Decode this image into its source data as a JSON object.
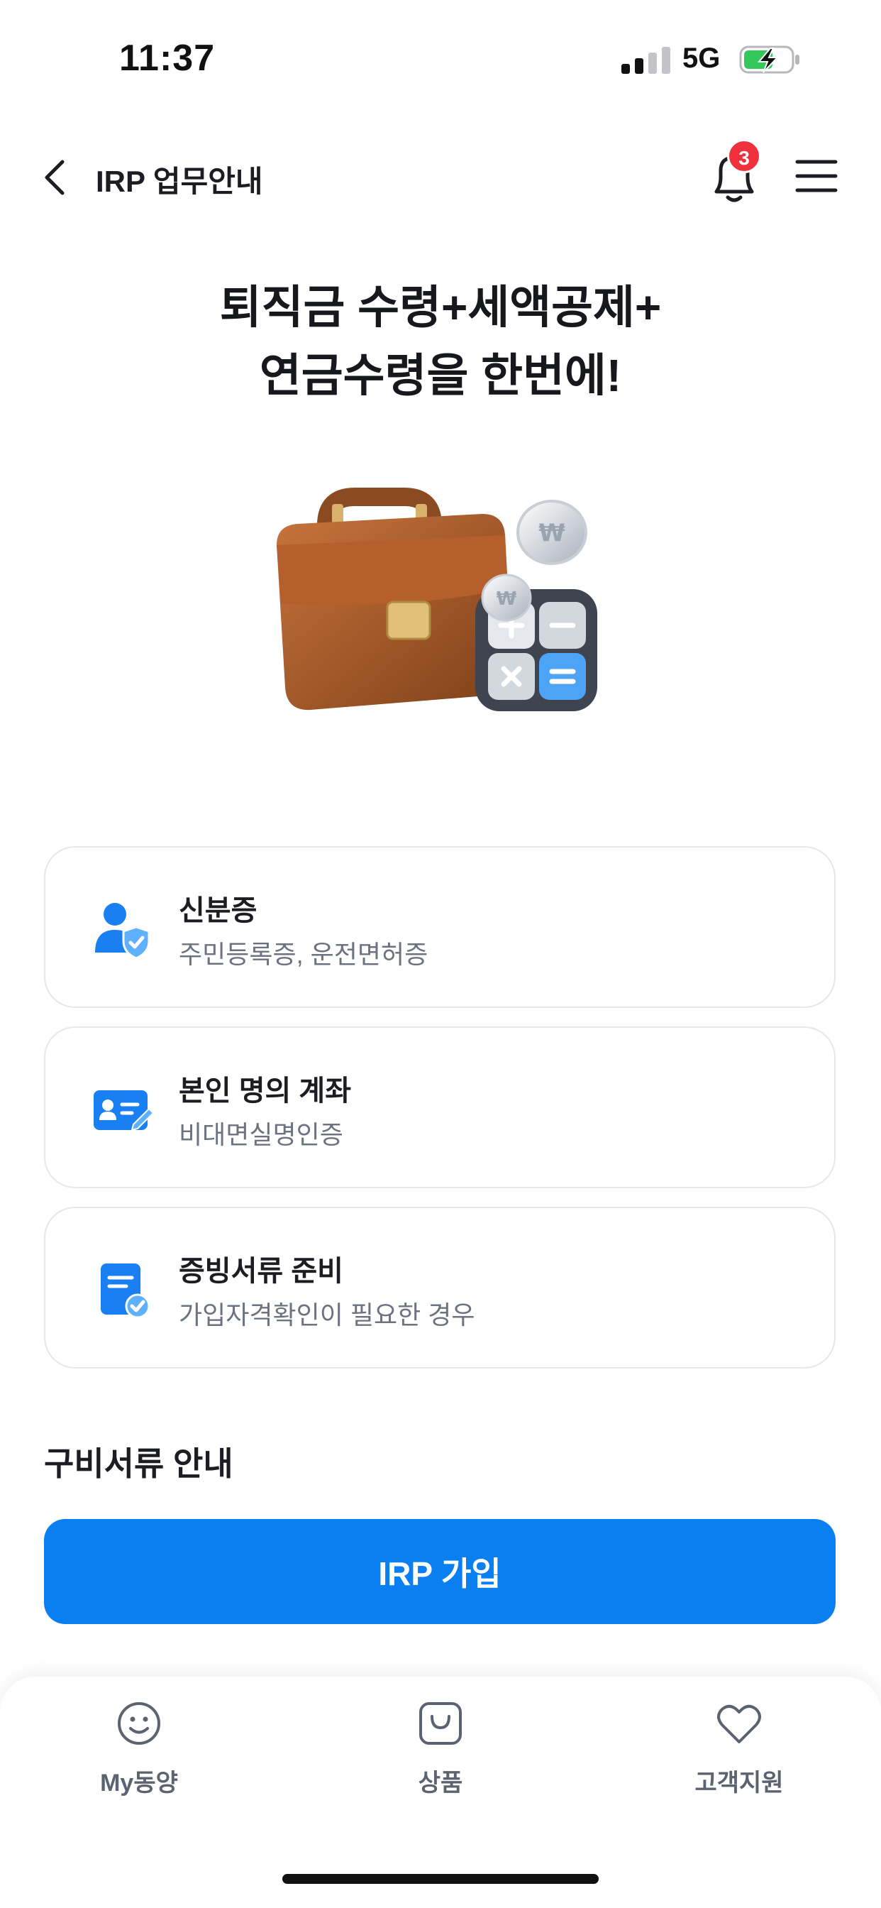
{
  "status_bar": {
    "time": "11:37",
    "network": "5G",
    "icons": [
      "signal-icon",
      "battery-charging-icon"
    ]
  },
  "header": {
    "title": "IRP 업무안내",
    "notification_count": "3",
    "icons": [
      "back-icon",
      "bell-icon",
      "menu-icon"
    ]
  },
  "headline": {
    "line1": "퇴직금 수령+세액공제+",
    "line2": "연금수령을 한번에!"
  },
  "hero": {
    "icons": [
      "briefcase-icon",
      "calculator-icon",
      "won-coin-icon"
    ]
  },
  "cards": [
    {
      "title": "신분증",
      "subtitle": "주민등록증, 운전면허증",
      "icon": "id-verified-icon"
    },
    {
      "title": "본인 명의 계좌",
      "subtitle": "비대면실명인증",
      "icon": "account-card-icon"
    },
    {
      "title": "증빙서류 준비",
      "subtitle": "가입자격확인이 필요한 경우",
      "icon": "document-check-icon"
    }
  ],
  "section_title": "구비서류 안내",
  "cta": {
    "label": "IRP 가입"
  },
  "bottom_nav": {
    "items": [
      {
        "label": "My동양",
        "icon": "smile-icon"
      },
      {
        "label": "상품",
        "icon": "shopping-bag-icon"
      },
      {
        "label": "고객지원",
        "icon": "heart-icon"
      }
    ]
  },
  "colors": {
    "accent": "#0a7ff2",
    "badge": "#f0303c",
    "subtitle_text": "#6b7280",
    "card_border": "#e5e7eb",
    "battery_green": "#34c759"
  }
}
